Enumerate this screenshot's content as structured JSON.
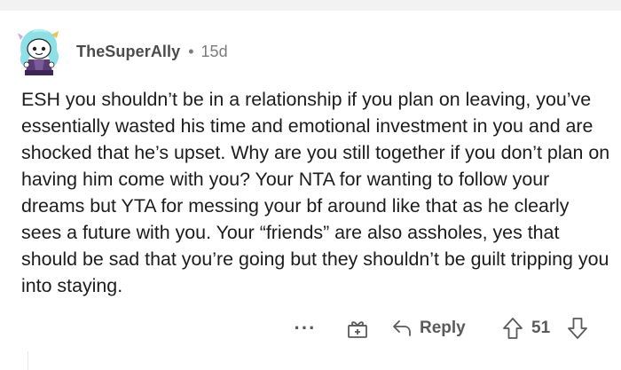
{
  "comment": {
    "author": "TheSuperAlly",
    "separator": "•",
    "age": "15d",
    "avatar_icon": "snoo-avatar-icon",
    "body": "ESH you shouldn’t be in a relationship if you plan on leaving, you’ve essentially wasted his time and emotional investment in you and are shocked that he’s upset. Why are you still together if you don’t plan on having him come with you? Your NTA for wanting to follow your dreams but YTA for messing your bf around like that as he clearly sees a future with you. Your “friends” are also assholes, yes that should be sad that you’re going but they shouldn’t be guilt tripping you into staying."
  },
  "actions": {
    "more_label": "···",
    "more_icon": "more-options-icon",
    "award_icon": "award-icon",
    "reply_icon": "reply-arrow-icon",
    "reply_label": "Reply",
    "upvote_icon": "upvote-arrow-icon",
    "score": "51",
    "downvote_icon": "downvote-arrow-icon"
  },
  "colors": {
    "text": "#1c1c1c",
    "meta": "#7c7c7c",
    "action": "#5a5a5a",
    "band": "#f2f2f2"
  }
}
